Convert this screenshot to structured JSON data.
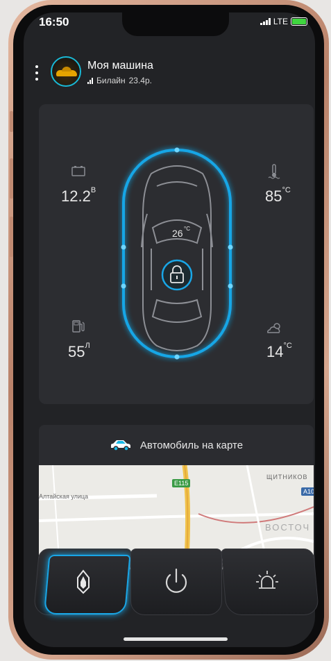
{
  "status": {
    "time": "16:50",
    "network": "LTE"
  },
  "header": {
    "car_name": "Моя машина",
    "operator": "Билайн",
    "balance": "23.4р."
  },
  "metrics": {
    "battery": {
      "value": "12.2",
      "unit": "В"
    },
    "engine_temp": {
      "value": "85",
      "unit": "°C"
    },
    "cabin_temp": {
      "value": "26",
      "unit": "°C"
    },
    "fuel": {
      "value": "55",
      "unit": "Л"
    },
    "outside_temp": {
      "value": "14",
      "unit": "°C"
    }
  },
  "map_card": {
    "title": "Автомобиль на карте"
  },
  "map": {
    "labels": [
      "Алтайская улица",
      "ЩИТНИКОВ",
      "ВОСТОЧ",
      "E115",
      "A10"
    ]
  },
  "colors": {
    "accent": "#19b9e6",
    "map_road": "#f0c24a"
  },
  "icons": [
    "battery-icon",
    "engine-temp-icon",
    "fuel-icon",
    "weather-icon",
    "lock-icon",
    "car-icon",
    "key-icon",
    "power-icon",
    "siren-icon"
  ]
}
